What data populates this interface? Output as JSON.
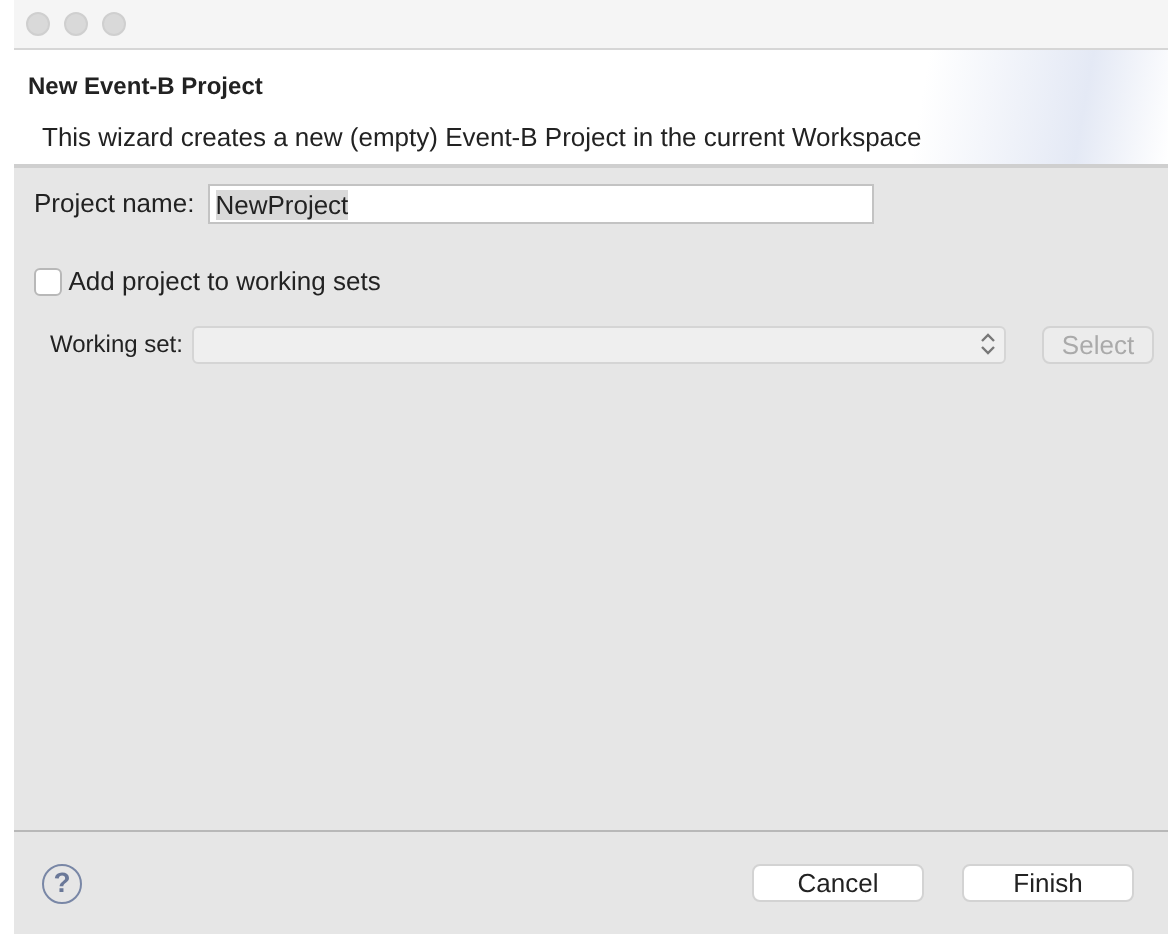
{
  "header": {
    "title": "New Event-B Project",
    "description": "This wizard creates a new (empty) Event-B Project in the current Workspace"
  },
  "project_name": {
    "label": "Project name:",
    "value": "NewProject"
  },
  "working_sets_checkbox": {
    "label": "Add project to working sets",
    "checked": false
  },
  "working_set": {
    "label": "Working set:",
    "disabled": true
  },
  "select_button": {
    "label": "Select",
    "disabled": true
  },
  "footer": {
    "help": "?",
    "buttons": [
      {
        "label": "Cancel"
      },
      {
        "label": "Finish"
      }
    ]
  }
}
